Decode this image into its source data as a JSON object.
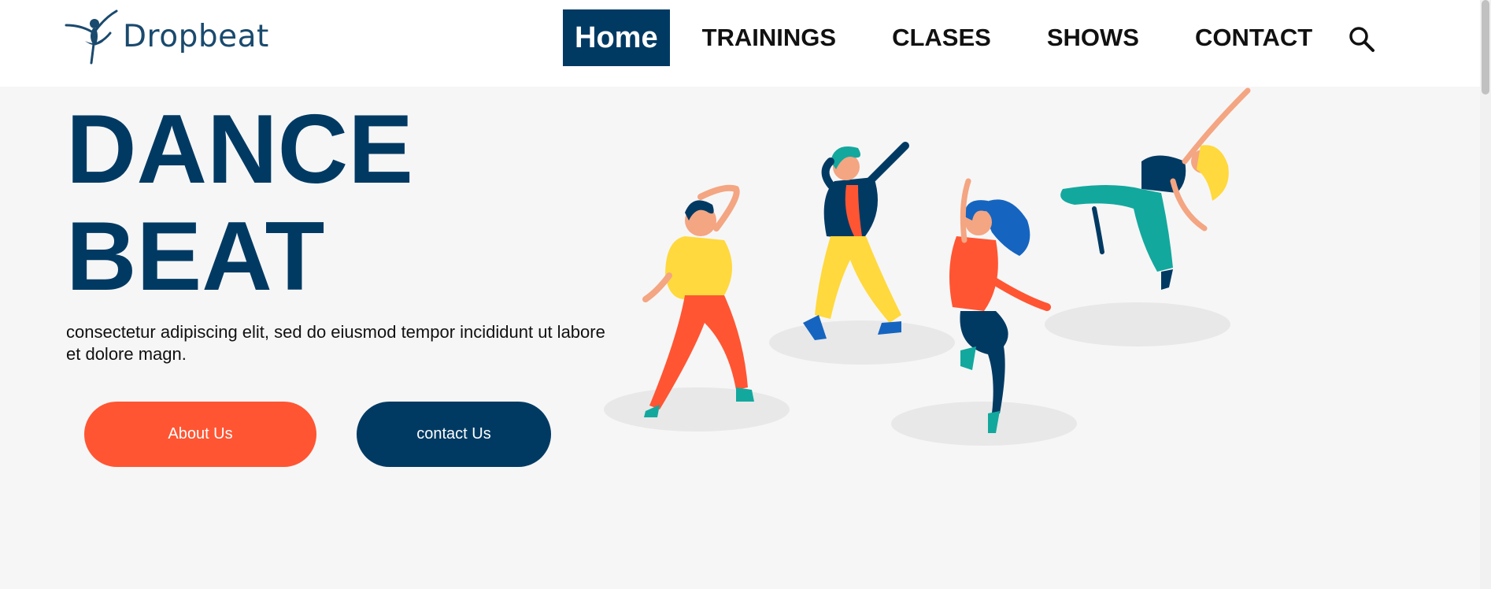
{
  "brand": {
    "name": "Dropbeat",
    "color": "#1a4a6e"
  },
  "nav": {
    "items": [
      {
        "label": "Home",
        "active": true
      },
      {
        "label": "TRAININGS",
        "active": false
      },
      {
        "label": "CLASES",
        "active": false
      },
      {
        "label": "SHOWS",
        "active": false
      },
      {
        "label": "CONTACT",
        "active": false
      }
    ],
    "search_icon": "search-icon",
    "active_color": "#003a63"
  },
  "hero": {
    "title_line1": "DANCE",
    "title_line2": "BEAT",
    "text": "consectetur adipiscing elit, sed do eiusmod tempor incididunt ut labore et dolore magn.",
    "title_color": "#003a63"
  },
  "buttons": {
    "about_label": "About Us",
    "about_color": "#ff5533",
    "contact_label": "contact Us",
    "contact_color": "#003a63"
  },
  "illustration": {
    "icon": "dancers-illustration",
    "palette": [
      "#ffd93d",
      "#ff5533",
      "#13a89e",
      "#003a63",
      "#1565c0"
    ]
  }
}
